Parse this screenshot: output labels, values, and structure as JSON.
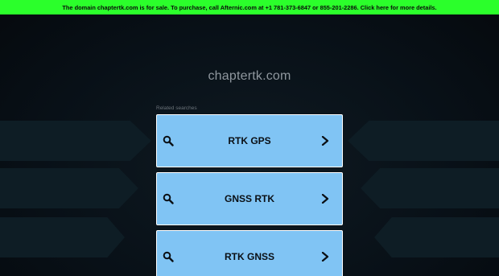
{
  "banner": {
    "text": "The domain chaptertk.com is for sale. To purchase, call Afternic.com at +1 781-373-6847 or 855-201-2286. Click here for more details."
  },
  "site": {
    "domain": "chaptertk.com"
  },
  "related": {
    "heading": "Related searches",
    "items": [
      {
        "label": "RTK GPS"
      },
      {
        "label": "GNSS RTK"
      },
      {
        "label": "RTK GNSS"
      }
    ]
  },
  "icons": {
    "search": "search-icon",
    "chevron": "chevron-right-icon"
  },
  "colors": {
    "banner_bg": "#2bff2b",
    "page_bg": "#0a1016",
    "card_bg": "#80c4f4",
    "card_border": "#ffffff"
  }
}
